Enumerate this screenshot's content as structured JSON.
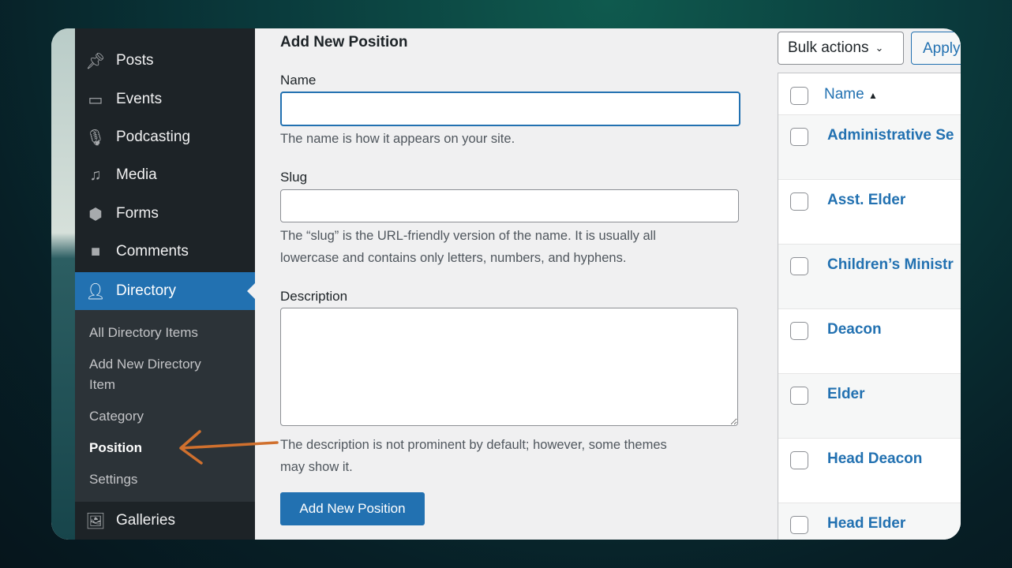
{
  "sidebar": {
    "items": [
      {
        "label": "Posts",
        "icon": "pin-icon"
      },
      {
        "label": "Events",
        "icon": "calendar-icon"
      },
      {
        "label": "Podcasting",
        "icon": "microphone-icon"
      },
      {
        "label": "Media",
        "icon": "media-icon"
      },
      {
        "label": "Forms",
        "icon": "forms-icon"
      },
      {
        "label": "Comments",
        "icon": "comment-icon"
      },
      {
        "label": "Directory",
        "icon": "user-icon"
      }
    ],
    "submenu": [
      "All Directory Items",
      "Add New Directory",
      "Item",
      "Category",
      "Position",
      "Settings"
    ],
    "after": {
      "label": "Galleries",
      "icon": "gallery-icon"
    }
  },
  "form": {
    "title": "Add New Position",
    "name_label": "Name",
    "name_value": "",
    "name_help": "The name is how it appears on your site.",
    "slug_label": "Slug",
    "slug_help1": "The “slug” is the URL-friendly version of the name. It is usually all",
    "slug_help2": "lowercase and contains only letters, numbers, and hyphens.",
    "desc_label": "Description",
    "desc_help1": "The description is not prominent by default; however, some themes",
    "desc_help2": "may show it.",
    "submit": "Add New Position"
  },
  "table": {
    "bulk": "Bulk actions",
    "apply": "Apply",
    "col_name": "Name",
    "rows": [
      "Administrative Se",
      "Asst. Elder",
      "Children’s Ministr",
      "Deacon",
      "Elder",
      "Head Deacon",
      "Head Elder"
    ]
  },
  "colors": {
    "accent": "#2271b1",
    "sidebar": "#1d2327",
    "annotation_arrow": "#d0702e"
  }
}
